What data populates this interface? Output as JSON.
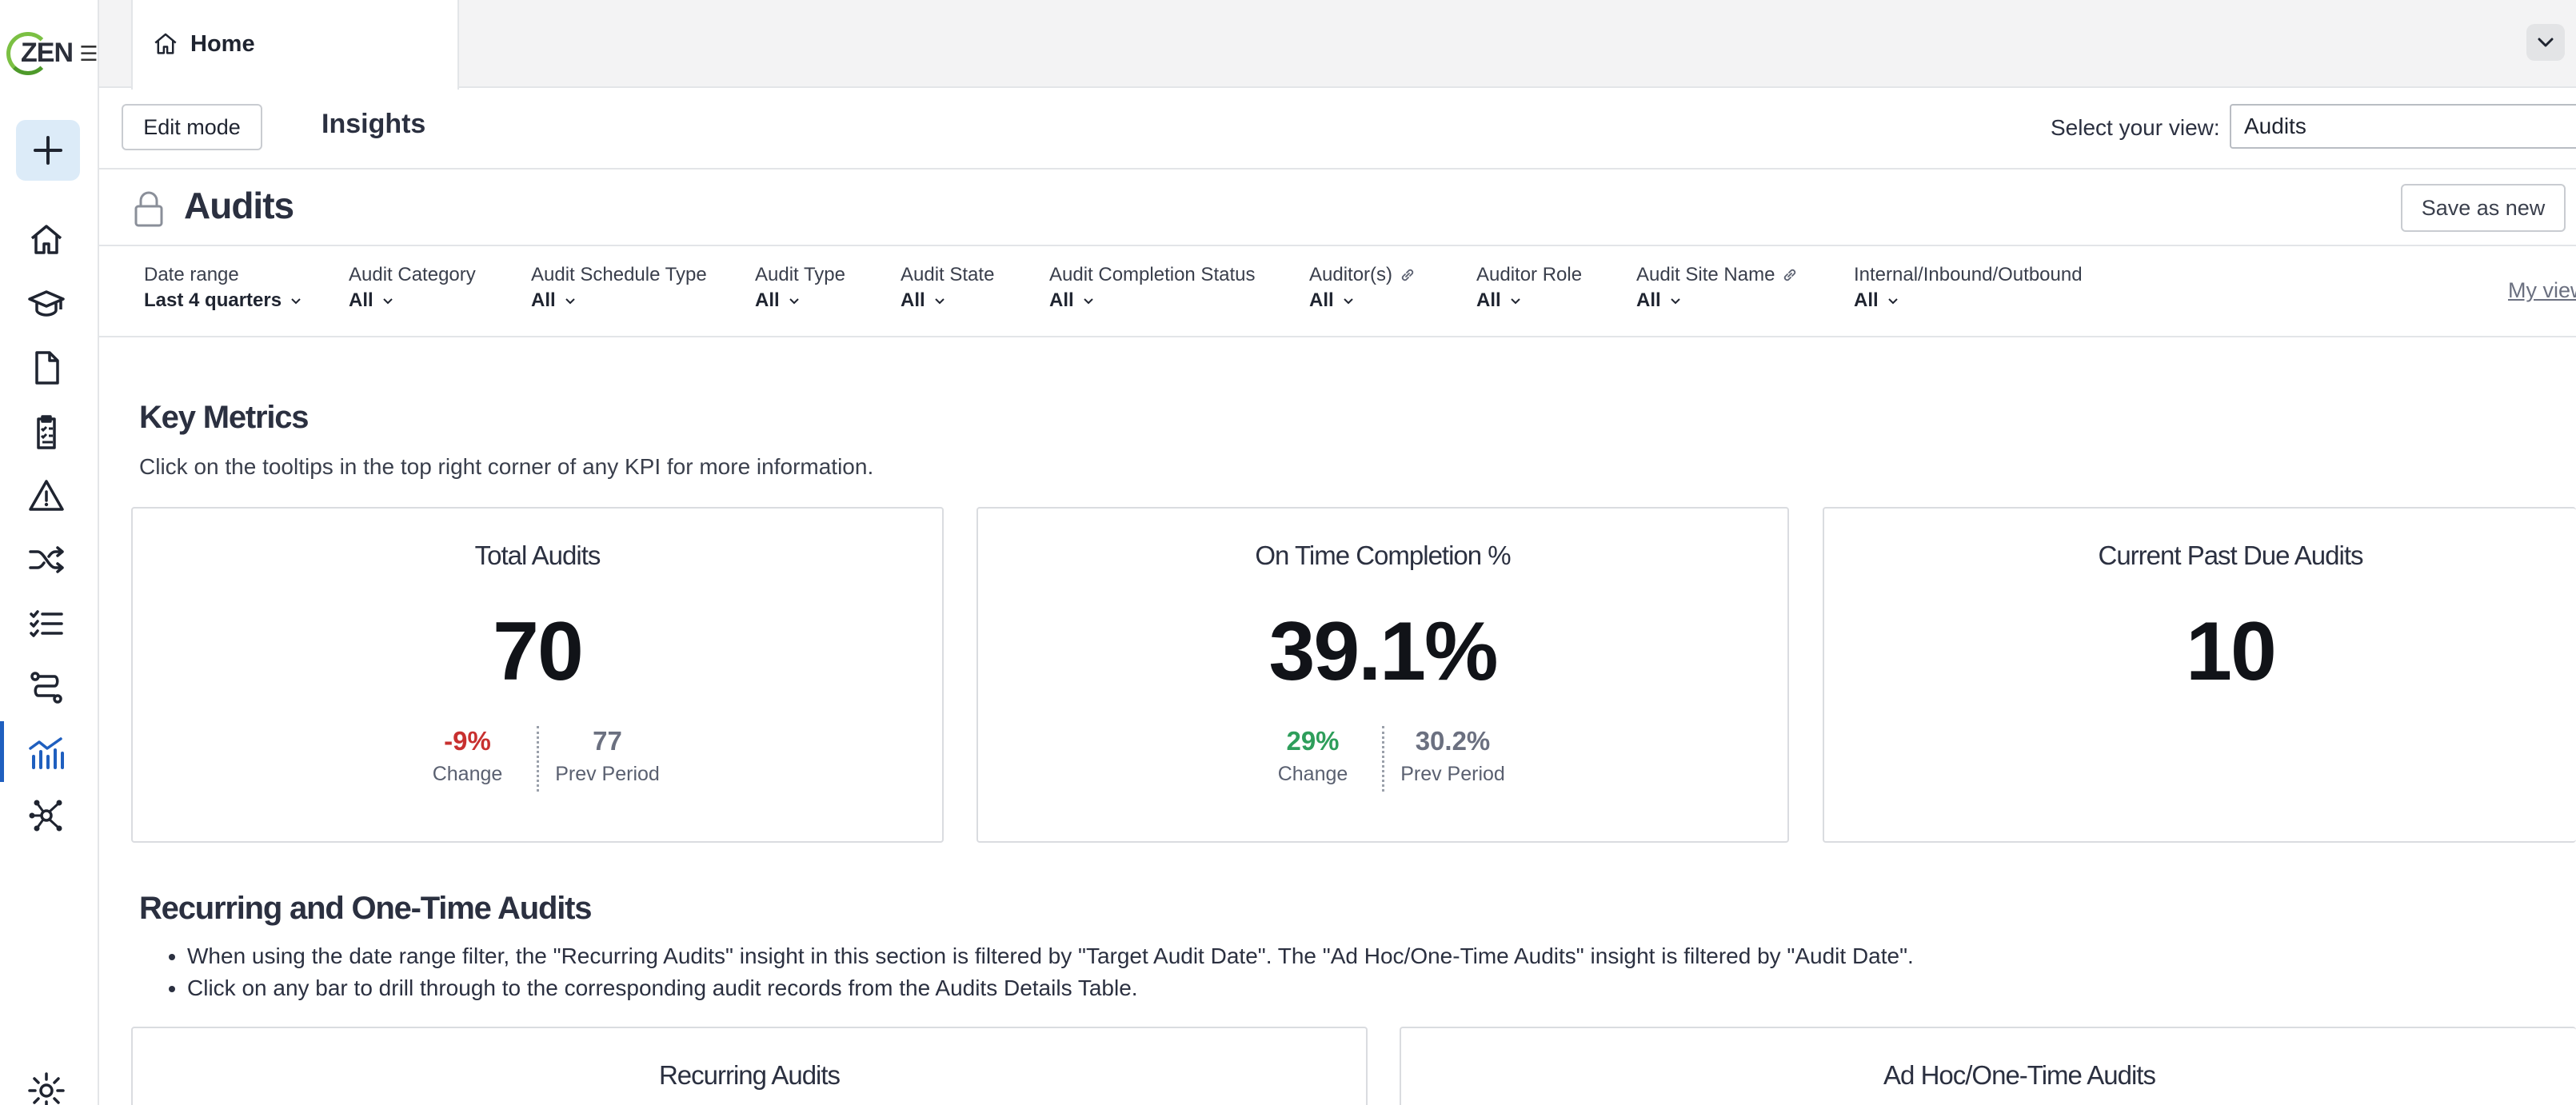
{
  "app": {
    "logo_text": "ZEN"
  },
  "tabs": [
    {
      "label": "Home"
    }
  ],
  "header": {
    "edit_mode_label": "Edit mode",
    "insights_title": "Insights",
    "view_label": "Select your view:",
    "view_value": "Audits"
  },
  "dashboard": {
    "title": "Audits",
    "save_as_new_label": "Save as new",
    "my_views_label": "My views"
  },
  "filters": [
    {
      "label": "Date range",
      "value": "Last 4 quarters",
      "link": false
    },
    {
      "label": "Audit Category",
      "value": "All",
      "link": false
    },
    {
      "label": "Audit Schedule Type",
      "value": "All",
      "link": false
    },
    {
      "label": "Audit Type",
      "value": "All",
      "link": false
    },
    {
      "label": "Audit State",
      "value": "All",
      "link": false
    },
    {
      "label": "Audit Completion Status",
      "value": "All",
      "link": false
    },
    {
      "label": "Auditor(s)",
      "value": "All",
      "link": true
    },
    {
      "label": "Auditor Role",
      "value": "All",
      "link": false
    },
    {
      "label": "Audit Site Name",
      "value": "All",
      "link": true
    },
    {
      "label": "Internal/Inbound/Outbound",
      "value": "All",
      "link": false
    }
  ],
  "key_metrics": {
    "title": "Key Metrics",
    "subtitle": "Click on the tooltips in the top right corner of any KPI for more information.",
    "kpis": [
      {
        "title": "Total Audits",
        "value": "70",
        "change": "-9%",
        "change_color": "#c8302f",
        "change_label": "Change",
        "prev": "77",
        "prev_label": "Prev Period"
      },
      {
        "title": "On Time Completion %",
        "value": "39.1%",
        "change": "29%",
        "change_color": "#2e9e5b",
        "change_label": "Change",
        "prev": "30.2%",
        "prev_label": "Prev Period"
      },
      {
        "title": "Current Past Due Audits",
        "value": "10"
      }
    ]
  },
  "recurring": {
    "title": "Recurring and One-Time Audits",
    "bullets": [
      "When using the date range filter, the \"Recurring Audits\" insight in this section is filtered by \"Target Audit Date\". The \"Ad Hoc/One-Time Audits\" insight is filtered by \"Audit Date\".",
      "Click on any bar to drill through to the corresponding audit records from the Audits Details Table."
    ],
    "charts": [
      {
        "title": "Recurring Audits"
      },
      {
        "title": "Ad Hoc/One-Time Audits"
      }
    ]
  },
  "colors": {
    "accent": "#1f5fbf",
    "add_bg": "#dcebf8",
    "negative": "#c8302f",
    "positive": "#2e9e5b"
  },
  "rail_icons": [
    "plus-icon",
    "home-icon",
    "graduation-cap-icon",
    "document-icon",
    "clipboard-checklist-icon",
    "warning-icon",
    "shuffle-icon",
    "checklist-icon",
    "route-icon",
    "analytics-chart-icon",
    "network-icon",
    "gear-icon"
  ]
}
